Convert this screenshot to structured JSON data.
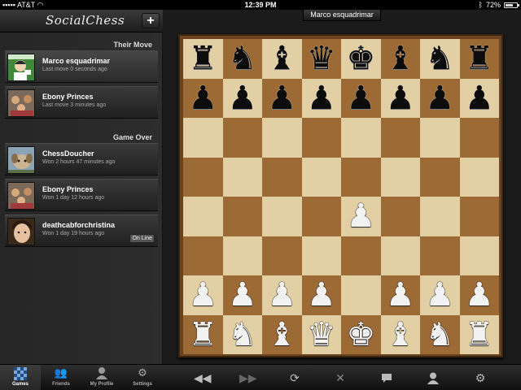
{
  "status_bar": {
    "carrier": "AT&T",
    "time": "12:39 PM",
    "battery": "72%",
    "battery_level": 0.72
  },
  "sidebar": {
    "app_title": "SocialChess",
    "add_label": "+",
    "sections": [
      {
        "header": "Their Move",
        "games": [
          {
            "name": "Marco esquadrimar",
            "status": "Last move 0 seconds ago",
            "selected": true
          },
          {
            "name": "Ebony Princes",
            "status": "Last move 3 minutes ago",
            "selected": false
          }
        ]
      },
      {
        "header": "Game Over",
        "games": [
          {
            "name": "ChessDoucher",
            "status": "Won 2 hours 47 minutes ago"
          },
          {
            "name": "Ebony Princes",
            "status": "Won 1 day 12 hours ago"
          },
          {
            "name": "deathcabforchristina",
            "status": "Won 1 day 19 hours ago",
            "badge": "On Line"
          }
        ]
      }
    ]
  },
  "board": {
    "opponent_title": "Marco esquadrimar",
    "rows": [
      [
        "r",
        "n",
        "b",
        "q",
        "k",
        "b",
        "n",
        "r"
      ],
      [
        "p",
        "p",
        "p",
        "p",
        "p",
        "p",
        "p",
        "p"
      ],
      [
        "",
        "",
        "",
        "",
        "",
        "",
        "",
        ""
      ],
      [
        "",
        "",
        "",
        "",
        "",
        "",
        "",
        ""
      ],
      [
        "",
        "",
        "",
        "",
        "P",
        "",
        "",
        ""
      ],
      [
        "",
        "",
        "",
        "",
        "",
        "",
        "",
        ""
      ],
      [
        "P",
        "P",
        "P",
        "P",
        "",
        "P",
        "P",
        "P"
      ],
      [
        "R",
        "N",
        "B",
        "Q",
        "K",
        "B",
        "N",
        "R"
      ]
    ]
  },
  "toolbar": {
    "tabs": [
      {
        "label": "Games",
        "icon": "checkerboard-icon",
        "active": true
      },
      {
        "label": "Friends",
        "icon": "friends-icon"
      },
      {
        "label": "My Profile",
        "icon": "profile-icon"
      },
      {
        "label": "Settings",
        "icon": "settings-gear-icon"
      }
    ],
    "buttons": [
      {
        "name": "rewind",
        "icon": "rewind-icon"
      },
      {
        "name": "fast-forward",
        "icon": "fast-forward-icon"
      },
      {
        "name": "refresh",
        "icon": "refresh-icon"
      },
      {
        "name": "resign",
        "icon": "close-icon"
      },
      {
        "name": "chat",
        "icon": "chat-bubble-icon"
      },
      {
        "name": "opponent",
        "icon": "person-icon"
      },
      {
        "name": "options",
        "icon": "gear-icon"
      }
    ]
  }
}
